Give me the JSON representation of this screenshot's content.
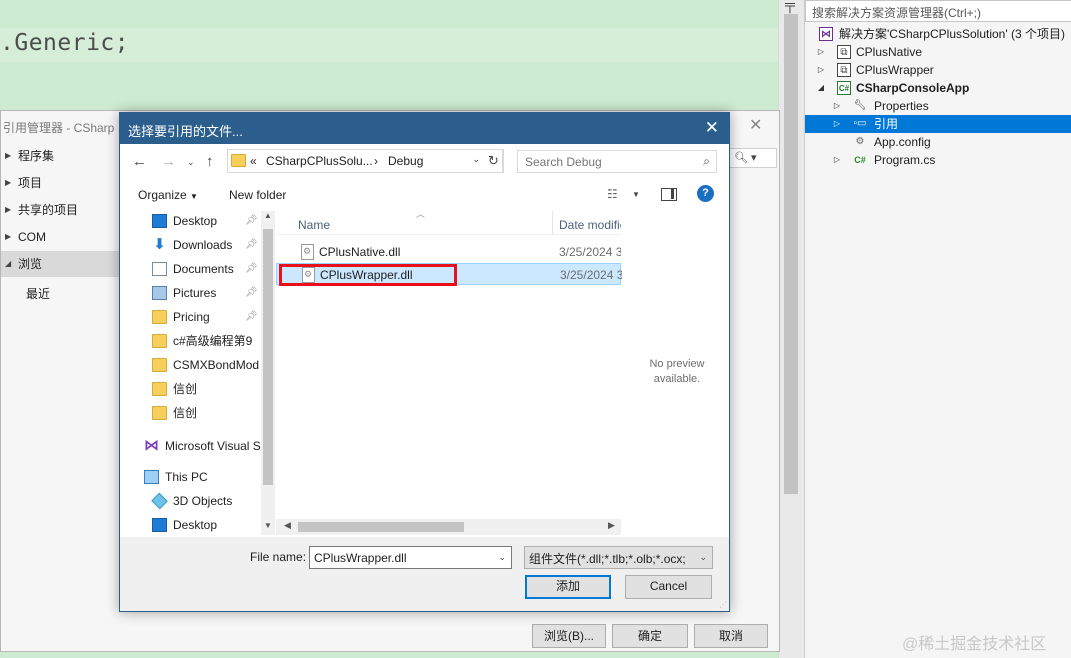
{
  "editor": {
    "code_text": ".Generic;"
  },
  "solution_explorer": {
    "search_placeholder": "搜索解决方案资源管理器(Ctrl+;)",
    "items": [
      {
        "label": "解决方案'CSharpCPlusSolution' (3 个项目)",
        "icon": "solution-icon"
      },
      {
        "label": "CPlusNative",
        "icon": "cpp-project-icon"
      },
      {
        "label": "CPlusWrapper",
        "icon": "cpp-project-icon"
      },
      {
        "label": "CSharpConsoleApp",
        "icon": "csharp-project-icon"
      },
      {
        "label": "Properties",
        "icon": "wrench-icon"
      },
      {
        "label": "引用",
        "icon": "references-icon",
        "selected": true
      },
      {
        "label": "App.config",
        "icon": "config-file-icon"
      },
      {
        "label": "Program.cs",
        "icon": "csharp-file-icon"
      }
    ]
  },
  "reference_manager": {
    "title": "引用管理器 - CSharp",
    "nav": [
      {
        "label": "程序集"
      },
      {
        "label": "项目"
      },
      {
        "label": "共享的项目"
      },
      {
        "label": "COM"
      },
      {
        "label": "浏览",
        "active": true
      },
      {
        "label": "最近"
      }
    ],
    "search_icon": "search-icon",
    "buttons": {
      "browse": "浏览(B)...",
      "ok": "确定",
      "cancel": "取消"
    }
  },
  "file_dialog": {
    "title": "选择要引用的文件...",
    "address": {
      "prefix": "«",
      "parent": "CSharpCPlusSolu...",
      "separator": "›",
      "current": "Debug"
    },
    "search_placeholder": "Search Debug",
    "toolbar": {
      "organize": "Organize",
      "new_folder": "New folder",
      "help": "?"
    },
    "nav_items": [
      {
        "label": "Desktop",
        "icon": "desktop-icon",
        "pinned": true
      },
      {
        "label": "Downloads",
        "icon": "downloads-icon",
        "pinned": true
      },
      {
        "label": "Documents",
        "icon": "documents-icon",
        "pinned": true
      },
      {
        "label": "Pictures",
        "icon": "pictures-icon",
        "pinned": true
      },
      {
        "label": "Pricing",
        "icon": "folder-icon",
        "pinned": true
      },
      {
        "label": "c#高级编程第9",
        "icon": "folder-icon",
        "pinned": false
      },
      {
        "label": "CSMXBondMod",
        "icon": "folder-icon",
        "pinned": false
      },
      {
        "label": "信创",
        "icon": "folder-icon",
        "pinned": false
      },
      {
        "label": "信创",
        "icon": "folder-icon",
        "pinned": false
      },
      {
        "label": "Microsoft Visual S",
        "icon": "visual-studio-icon",
        "pinned": false
      },
      {
        "label": "This PC",
        "icon": "this-pc-icon",
        "pinned": false
      },
      {
        "label": "3D Objects",
        "icon": "3d-objects-icon",
        "pinned": false
      },
      {
        "label": "Desktop",
        "icon": "desktop-icon",
        "pinned": false
      }
    ],
    "columns": {
      "name": "Name",
      "date": "Date modified"
    },
    "files": [
      {
        "name": "CPlusNative.dll",
        "date": "3/25/2024 3",
        "selected": false
      },
      {
        "name": "CPlusWrapper.dll",
        "date": "3/25/2024 3",
        "selected": true
      }
    ],
    "preview": {
      "line1": "No preview",
      "line2": "available."
    },
    "file_name_label": "File name:",
    "file_name_value": "CPlusWrapper.dll",
    "file_type": "组件文件(*.dll;*.tlb;*.olb;*.ocx;",
    "buttons": {
      "add": "添加",
      "cancel": "Cancel"
    }
  },
  "watermark": "@稀土掘金技术社区"
}
